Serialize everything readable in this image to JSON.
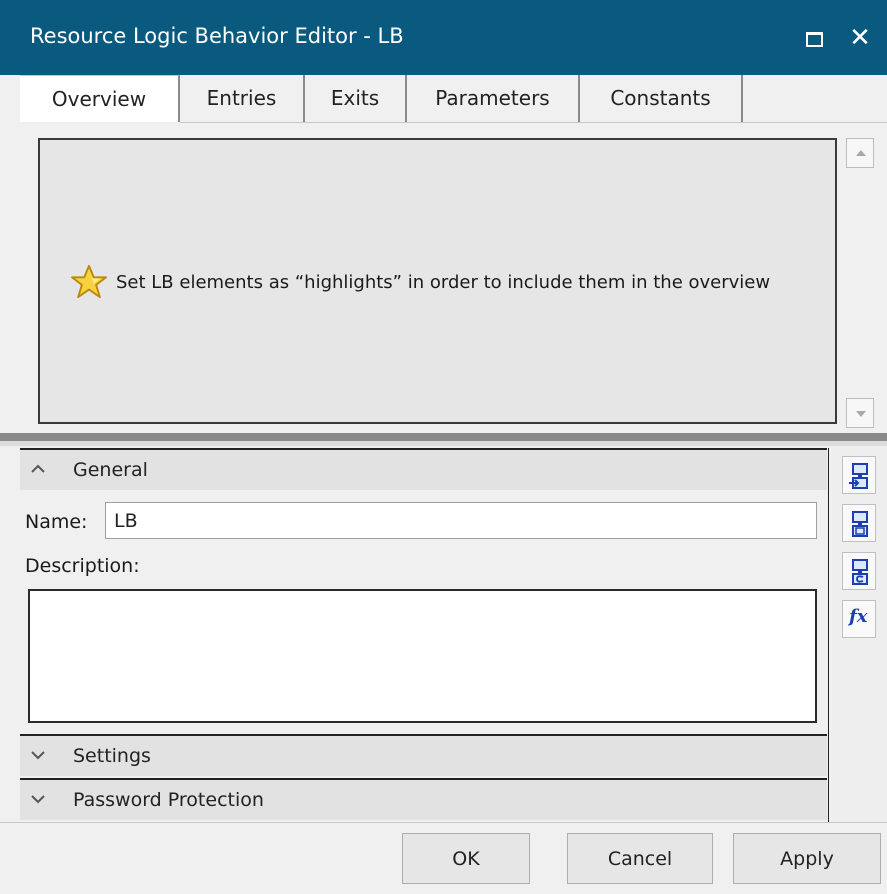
{
  "window": {
    "title": "Resource Logic Behavior Editor - LB",
    "close_glyph": "✕",
    "title_bar_color": "#0a5a80"
  },
  "tabs": [
    {
      "label": "Overview",
      "active": true
    },
    {
      "label": "Entries",
      "active": false
    },
    {
      "label": "Exits",
      "active": false
    },
    {
      "label": "Parameters",
      "active": false
    },
    {
      "label": "Constants",
      "active": false
    }
  ],
  "overview": {
    "message": "Set LB elements as “highlights” in order to include them in the overview",
    "icon": "star-icon"
  },
  "sections": {
    "general": {
      "label": "General",
      "expanded": true
    },
    "settings": {
      "label": "Settings",
      "expanded": false
    },
    "password": {
      "label": "Password Protection",
      "expanded": false
    }
  },
  "general": {
    "name_label": "Name:",
    "name_value": "LB",
    "description_label": "Description:",
    "description_value": ""
  },
  "side_tools": [
    {
      "icon": "add-entry-icon"
    },
    {
      "icon": "add-parameter-icon"
    },
    {
      "icon": "add-constant-icon"
    },
    {
      "icon": "function-icon",
      "glyph": "fx"
    }
  ],
  "buttons": {
    "ok": "OK",
    "cancel": "Cancel",
    "apply": "Apply"
  }
}
